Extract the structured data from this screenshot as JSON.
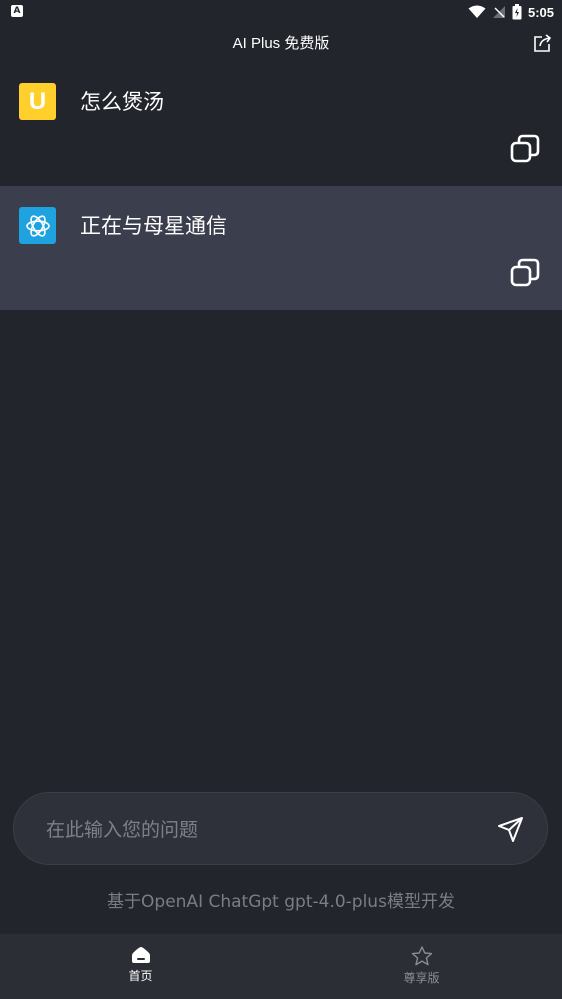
{
  "status_bar": {
    "notification_glyph": "A",
    "time": "5:05",
    "icons": [
      "wifi-icon",
      "signal-icon",
      "battery-icon"
    ]
  },
  "app_bar": {
    "title": "AI Plus 免费版",
    "share_icon": "share-icon"
  },
  "messages": [
    {
      "role": "user",
      "avatar_letter": "U",
      "text": "怎么煲汤",
      "avatar_color": "#ffd02b"
    },
    {
      "role": "ai",
      "text": "正在与母星通信",
      "avatar_color": "#1ea3e0"
    }
  ],
  "input": {
    "placeholder": "在此输入您的问题",
    "value": ""
  },
  "footer_note": "基于OpenAI ChatGpt gpt-4.0-plus模型开发",
  "bottom_nav": {
    "items": [
      {
        "label": "首页",
        "icon": "home-icon",
        "active": true
      },
      {
        "label": "尊享版",
        "icon": "star-icon",
        "active": false
      }
    ]
  },
  "colors": {
    "background": "#22252b",
    "ai_message_bg": "#3b3e4d",
    "nav_bg": "#2b2e35"
  }
}
